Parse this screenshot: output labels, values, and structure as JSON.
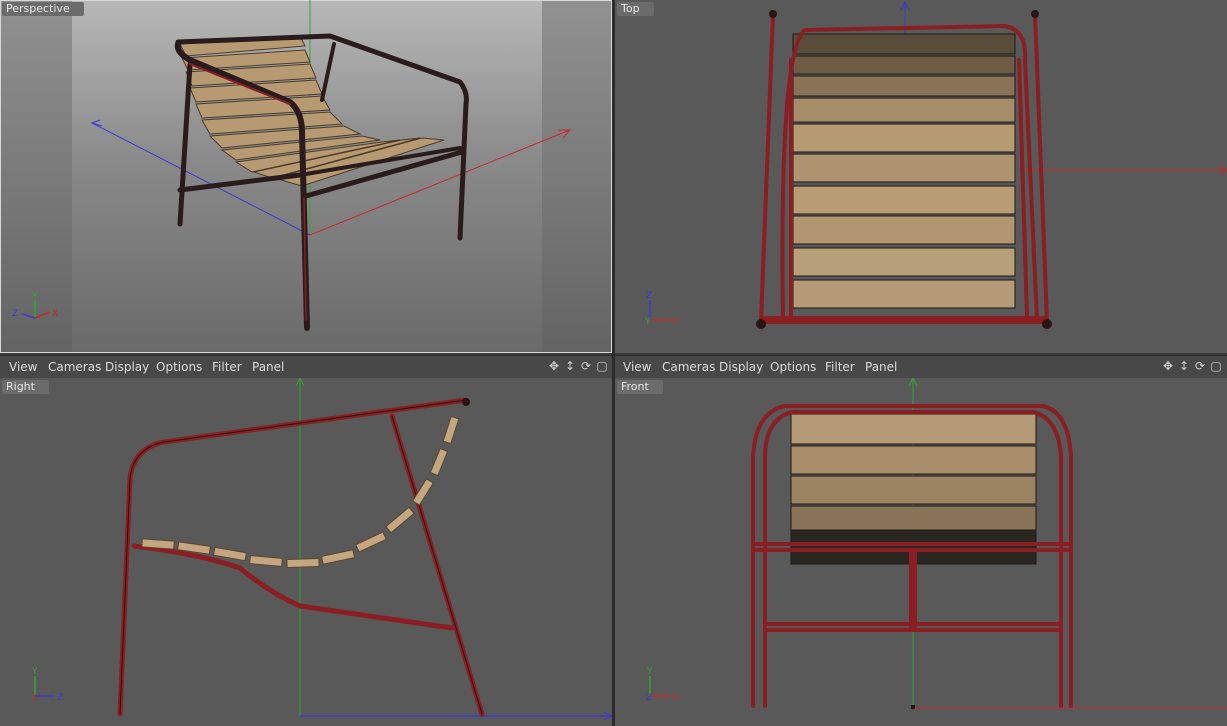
{
  "viewports": {
    "perspective": {
      "label": "Perspective",
      "axes": {
        "y": "Y",
        "x": "X",
        "z": "Z"
      }
    },
    "top": {
      "label": "Top",
      "axes": {
        "z": "Z",
        "y": "Y",
        "x": "X"
      }
    },
    "right": {
      "label": "Right",
      "axes": {
        "y": "Y",
        "x": "X",
        "z": "Z"
      }
    },
    "front": {
      "label": "Front",
      "axes": {
        "y": "Y",
        "z": "Z",
        "x": "X"
      }
    }
  },
  "menus": [
    "View",
    "Cameras",
    "Display",
    "Options",
    "Filter",
    "Panel"
  ],
  "nav_icons": [
    "move-view-icon",
    "dolly-view-icon",
    "rotate-view-icon",
    "toggle-layout-icon"
  ],
  "colors": {
    "frame_red": "#8a1e22",
    "frame_dark": "#2a1c1c",
    "wood": "#b89a72",
    "x_axis": "#c32a2a",
    "y_axis": "#2fa82f",
    "z_axis": "#3a3ad0"
  }
}
